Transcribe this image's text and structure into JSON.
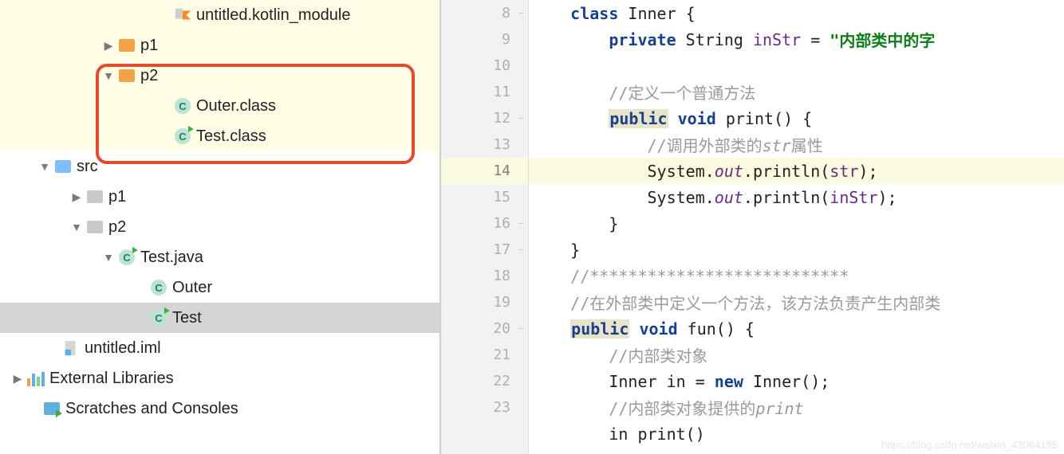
{
  "tree": {
    "kotlin_module": "untitled.kotlin_module",
    "p1_build": "p1",
    "p2_build": "p2",
    "outer_class": "Outer.class",
    "test_class": "Test.class",
    "src": "src",
    "p1_src": "p1",
    "p2_src": "p2",
    "test_java": "Test.java",
    "outer": "Outer",
    "test": "Test",
    "iml": "untitled.iml",
    "ext_lib": "External Libraries",
    "scratches": "Scratches and Consoles"
  },
  "gutter": {
    "lines": [
      "8",
      "9",
      "10",
      "11",
      "12",
      "13",
      "14",
      "15",
      "16",
      "17",
      "18",
      "19",
      "20",
      "21",
      "22",
      "23",
      ""
    ],
    "active_index": 6
  },
  "code": {
    "l8": {
      "indent": "    ",
      "kw1": "class",
      "rest": " Inner {"
    },
    "l9": {
      "indent": "        ",
      "kw1": "private",
      "mid": " String ",
      "fld": "inStr",
      "eq": " = ",
      "str": "\"内部类中的字"
    },
    "l10": {
      "indent": ""
    },
    "l11": {
      "indent": "        ",
      "cmt": "//定义一个普通方法"
    },
    "l12": {
      "indent": "        ",
      "kw1": "public",
      "sp": " ",
      "kw2": "void",
      "rest": " print() {"
    },
    "l13": {
      "indent": "            ",
      "cmt_a": "//调用外部类的",
      "cmt_i": "str",
      "cmt_b": "属性"
    },
    "l14": {
      "indent": "            ",
      "a": "System.",
      "fld": "out",
      "b": ".println(",
      "fld2": "str",
      "c": ");"
    },
    "l15": {
      "indent": "            ",
      "a": "System.",
      "fld": "out",
      "b": ".println(",
      "fld2": "inStr",
      "c": ");"
    },
    "l16": {
      "indent": "        ",
      "txt": "}"
    },
    "l17": {
      "indent": "    ",
      "txt": "}"
    },
    "l18": {
      "indent": "    ",
      "cmt": "//***************************"
    },
    "l19": {
      "indent": "    ",
      "cmt": "//在外部类中定义一个方法，该方法负责产生内部类"
    },
    "l20": {
      "indent": "    ",
      "kw1": "public",
      "sp": " ",
      "kw2": "void",
      "rest": " fun() {"
    },
    "l21": {
      "indent": "        ",
      "cmt": "//内部类对象"
    },
    "l22": {
      "indent": "        ",
      "a": "Inner in = ",
      "kw": "new",
      "b": " Inner();"
    },
    "l23": {
      "indent": "        ",
      "cmt_a": "//内部类对象提供的",
      "cmt_i": "print"
    },
    "l24": {
      "indent": "        ",
      "txt": "in print()"
    }
  },
  "watermark": "https://blog.csdn.net/weixin_43064185"
}
